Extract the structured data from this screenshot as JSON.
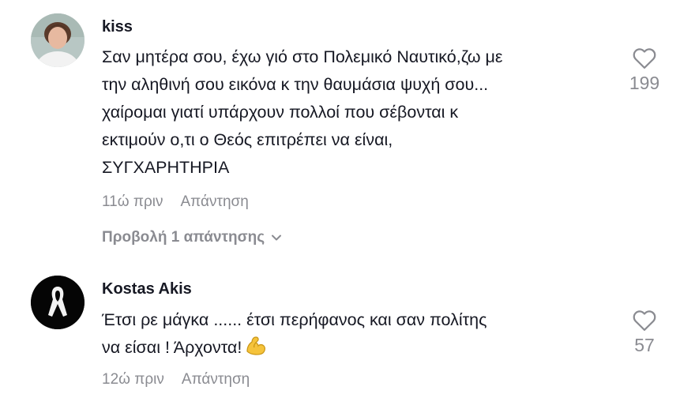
{
  "comments": [
    {
      "username": "kiss",
      "text_lines": [
        "Σαν μητέρα σου, έχω γιό στο Πολεμικό Ναυτικό,ζω με",
        "την αληθινή σου εικόνα κ την θαυμάσια ψυχή σου...",
        "χαίρομαι γιατί υπάρχουν πολλοί που σέβονται κ",
        "εκτιμούν ο,τι ο Θεός επιτρέπει να είναι,",
        "ΣΥΓΧΑΡΗΤΗΡΙΑ"
      ],
      "time": "11ώ πριν",
      "reply_label": "Απάντηση",
      "likes": "199",
      "view_replies": "Προβολή 1 απάντησης",
      "avatar_icon": "user-photo"
    },
    {
      "username": "Kostas Akis",
      "text_lines": [
        "Έτσι ρε μάγκα ...... έτσι περήφανος και σαν πολίτης",
        "να είσαι ! Άρχοντα!"
      ],
      "emoji_icon": "flexed-biceps-icon",
      "time": "12ώ πριν",
      "reply_label": "Απάντηση",
      "likes": "57",
      "avatar_icon": "black-ribbon-icon"
    }
  ],
  "colors": {
    "text": "#161823",
    "muted": "#8a8b91",
    "background": "#ffffff"
  }
}
